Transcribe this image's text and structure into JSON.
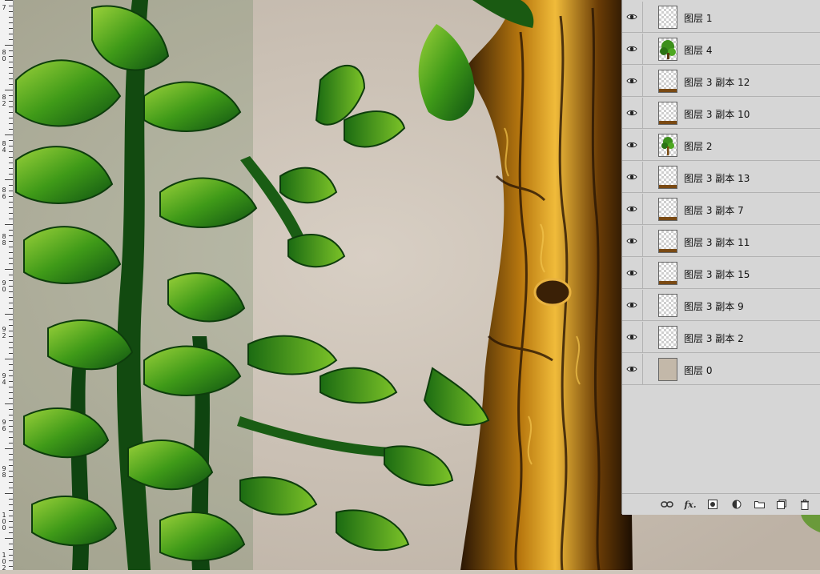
{
  "ruler": {
    "labels": [
      "7",
      "8\n0",
      "8\n2",
      "8\n4",
      "8\n6",
      "8\n8",
      "9\n0",
      "9\n2",
      "9\n4",
      "9\n6",
      "9\n8",
      "1\n0\n0",
      "1\n0\n2"
    ]
  },
  "layers": [
    {
      "name": "图层 1",
      "visible": true,
      "thumb": "transparent"
    },
    {
      "name": "图层 4",
      "visible": true,
      "thumb": "tree-green"
    },
    {
      "name": "图层 3 副本 12",
      "visible": true,
      "thumb": "transparent-brown"
    },
    {
      "name": "图层 3 副本 10",
      "visible": true,
      "thumb": "transparent-brown"
    },
    {
      "name": "图层 2",
      "visible": true,
      "thumb": "tree-small"
    },
    {
      "name": "图层 3 副本 13",
      "visible": true,
      "thumb": "transparent-brown"
    },
    {
      "name": "图层 3 副本 7",
      "visible": true,
      "thumb": "transparent-brown"
    },
    {
      "name": "图层 3 副本 11",
      "visible": true,
      "thumb": "transparent-brown"
    },
    {
      "name": "图层 3 副本 15",
      "visible": true,
      "thumb": "transparent-brown"
    },
    {
      "name": "图层 3 副本 9",
      "visible": true,
      "thumb": "transparent"
    },
    {
      "name": "图层 3 副本 2",
      "visible": true,
      "thumb": "transparent"
    },
    {
      "name": "图层 0",
      "visible": true,
      "thumb": "paper"
    }
  ],
  "footer_icons": [
    "link-icon",
    "fx-icon",
    "mask-icon",
    "adjustment-icon",
    "folder-icon",
    "new-layer-icon",
    "trash-icon"
  ],
  "footer_fx_label": "fx.",
  "colors": {
    "panel_bg": "#d6d6d6",
    "canvas_bg": "#cfc6bb",
    "leaf_green": "#4fa21a",
    "bark_gold": "#c98a1d"
  }
}
